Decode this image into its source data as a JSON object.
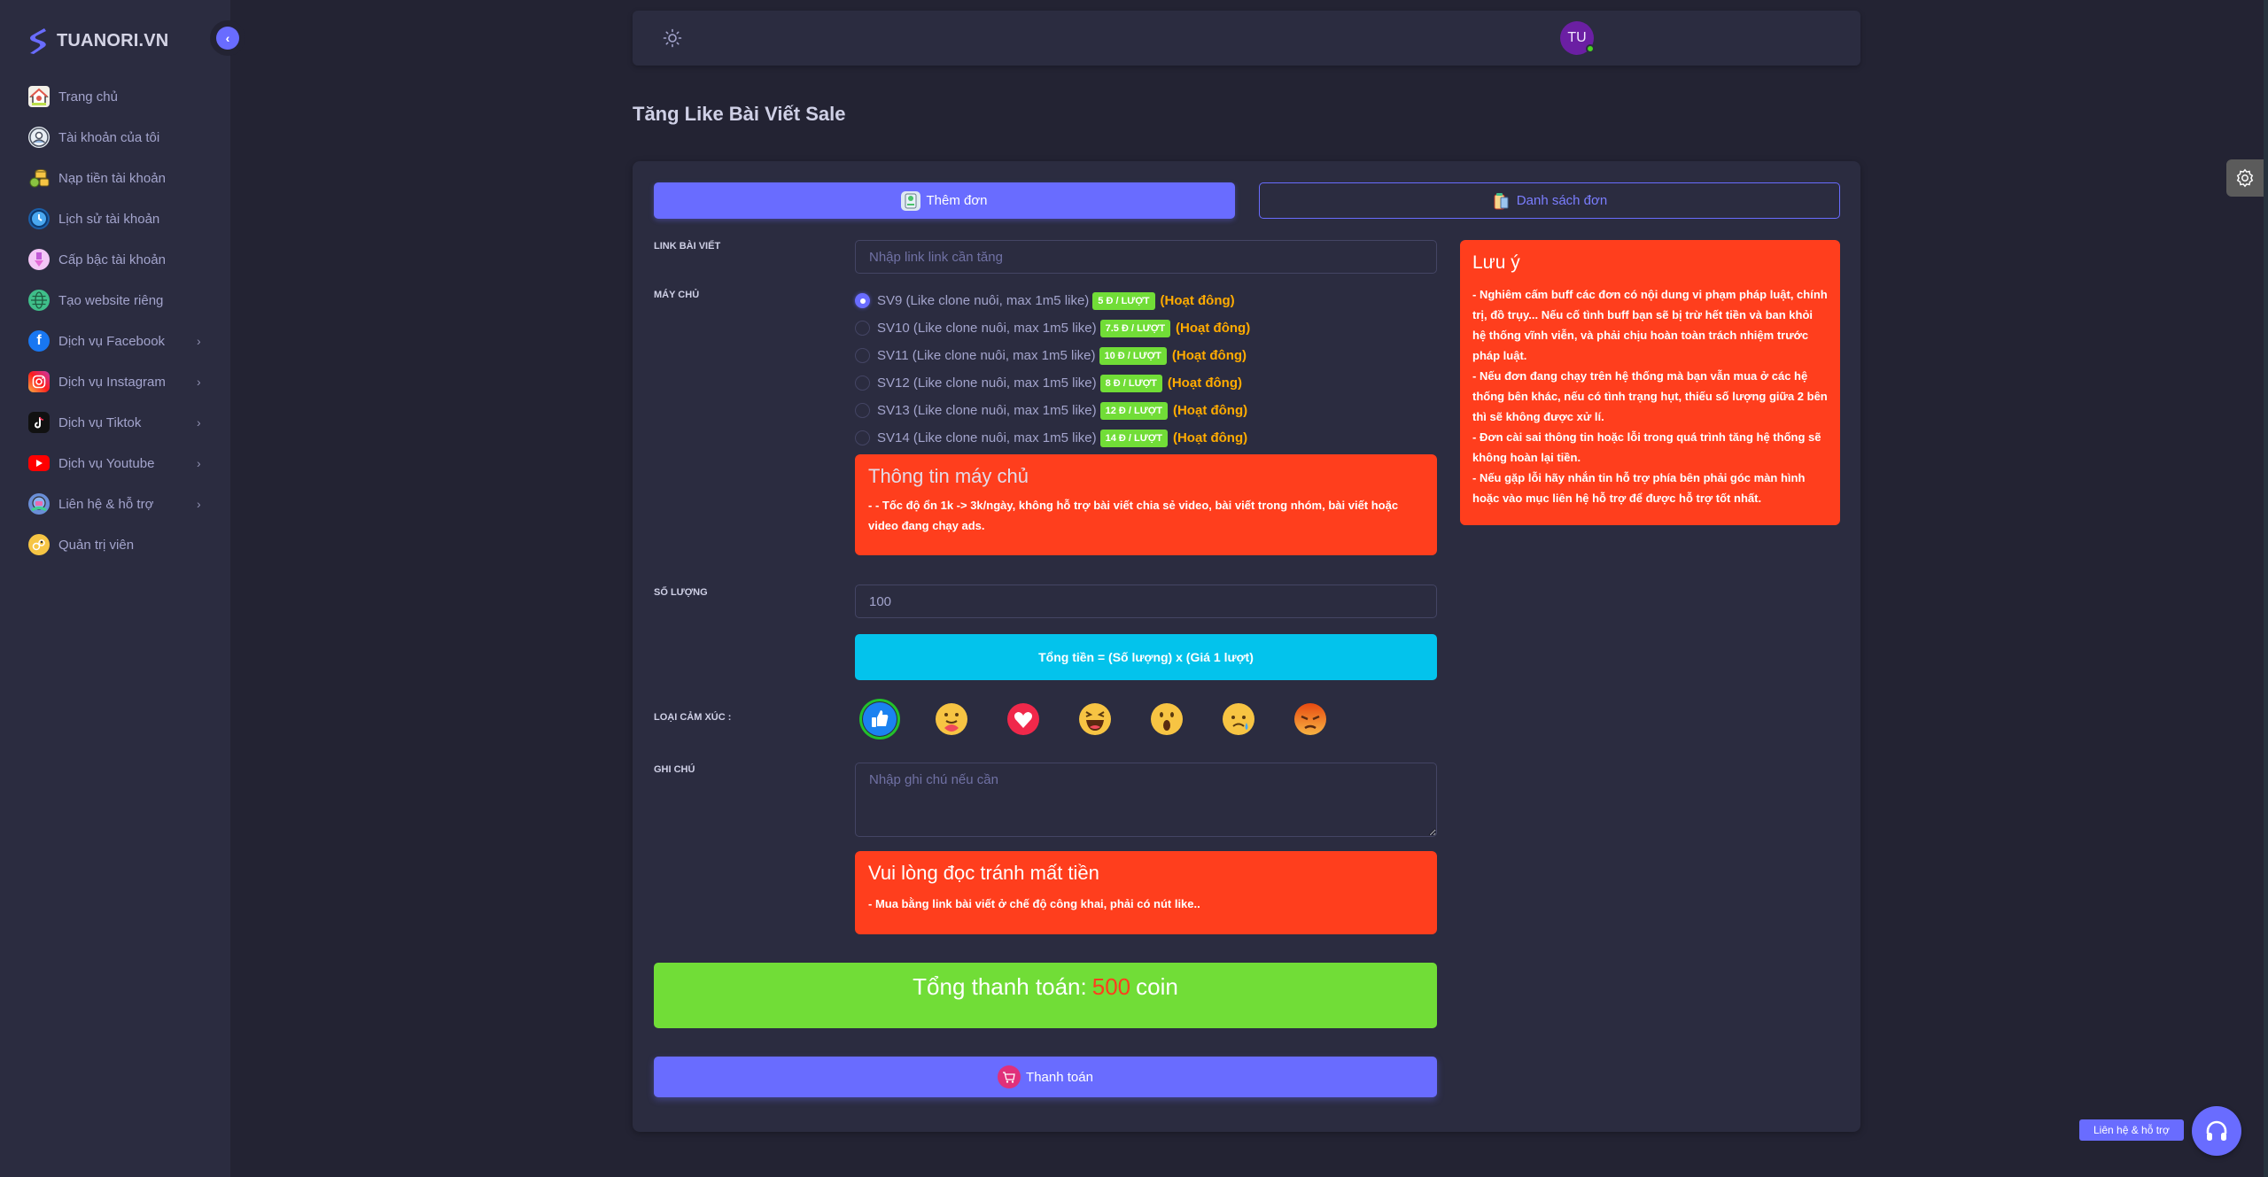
{
  "brand": {
    "name": "TUANORI.VN"
  },
  "sidebar": {
    "items": [
      {
        "label": "Trang chủ",
        "icon": "home-icon",
        "has_submenu": false
      },
      {
        "label": "Tài khoản của tôi",
        "icon": "user-icon",
        "has_submenu": false
      },
      {
        "label": "Nạp tiền tài khoản",
        "icon": "coins-icon",
        "has_submenu": false
      },
      {
        "label": "Lịch sử tài khoản",
        "icon": "clock-icon",
        "has_submenu": false
      },
      {
        "label": "Cấp bậc tài khoản",
        "icon": "rank-icon",
        "has_submenu": false
      },
      {
        "label": "Tạo website riêng",
        "icon": "globe-icon",
        "has_submenu": false
      },
      {
        "label": "Dịch vụ Facebook",
        "icon": "facebook-icon",
        "has_submenu": true
      },
      {
        "label": "Dịch vụ Instagram",
        "icon": "instagram-icon",
        "has_submenu": true
      },
      {
        "label": "Dịch vụ Tiktok",
        "icon": "tiktok-icon",
        "has_submenu": true
      },
      {
        "label": "Dịch vụ Youtube",
        "icon": "youtube-icon",
        "has_submenu": true
      },
      {
        "label": "Liên hệ & hỗ trợ",
        "icon": "support-icon",
        "has_submenu": true
      },
      {
        "label": "Quản trị viên",
        "icon": "admin-icon",
        "has_submenu": false
      }
    ],
    "chevron": "›",
    "collapse": "‹"
  },
  "header": {
    "avatar_initials": "TU",
    "status": "online"
  },
  "page": {
    "title": "Tăng Like Bài Viết Sale"
  },
  "tabs": {
    "add_order": "Thêm đơn",
    "order_list": "Danh sách đơn"
  },
  "form": {
    "link": {
      "label": "LINK BÀI VIẾT",
      "placeholder": "Nhập link link cần tăng",
      "value": ""
    },
    "server": {
      "label": "MÁY CHỦ",
      "selected": "SV9",
      "options": [
        {
          "id": "SV9",
          "name": "SV9 (Like clone nuôi, max 1m5 like)",
          "price": "5 Đ / LƯỢT",
          "status": "(Hoạt đông)"
        },
        {
          "id": "SV10",
          "name": "SV10 (Like clone nuôi, max 1m5 like)",
          "price": "7.5 Đ / LƯỢT",
          "status": "(Hoạt đông)"
        },
        {
          "id": "SV11",
          "name": "SV11 (Like clone nuôi, max 1m5 like)",
          "price": "10 Đ / LƯỢT",
          "status": "(Hoạt đông)"
        },
        {
          "id": "SV12",
          "name": "SV12 (Like clone nuôi, max 1m5 like)",
          "price": "8 Đ / LƯỢT",
          "status": "(Hoạt đông)"
        },
        {
          "id": "SV13",
          "name": "SV13 (Like clone nuôi, max 1m5 like)",
          "price": "12 Đ / LƯỢT",
          "status": "(Hoạt đông)"
        },
        {
          "id": "SV14",
          "name": "SV14 (Like clone nuôi, max 1m5 like)",
          "price": "14 Đ / LƯỢT",
          "status": "(Hoạt đông)"
        }
      ]
    },
    "server_info": {
      "title": "Thông tin máy chủ",
      "body": "- - Tốc độ ổn 1k -> 3k/ngày, không hỗ trợ bài viết chia sẻ video, bài viết trong nhóm, bài viết hoặc video đang chạy ads."
    },
    "quantity": {
      "label": "SỐ LƯỢNG",
      "value": "100"
    },
    "formula": "Tổng tiền = (Số lượng) x (Giá 1 lượt)",
    "reactions": {
      "label": "LOẠI CẢM XÚC :",
      "selected": "like",
      "options": [
        "like",
        "care",
        "love",
        "haha",
        "wow",
        "sad",
        "angry"
      ]
    },
    "note": {
      "label": "GHI CHÚ",
      "placeholder": "Nhập ghi chú nếu cần",
      "value": ""
    },
    "warning": {
      "title": "Vui lòng đọc tránh mất tiền",
      "body": "- Mua bằng link bài viết ở chế độ công khai, phải có nút like.."
    },
    "total": {
      "prefix": "Tổng thanh toán:",
      "amount": "500",
      "unit": "coin"
    },
    "pay_button": "Thanh toán"
  },
  "notice": {
    "title": "Lưu ý",
    "lines": [
      "- Nghiêm cấm buff các đơn có nội dung vi phạm pháp luật, chính trị, đồ trụy... Nếu cố tình buff bạn sẽ bị trừ hết tiền và ban khỏi hệ thống vĩnh viễn, và phải chịu hoàn toàn trách nhiệm trước pháp luật.",
      "- Nếu đơn đang chạy trên hệ thống mà bạn vẫn mua ở các hệ thống bên khác, nếu có tình trạng hụt, thiếu số lượng giữa 2 bên thì sẽ không được xử lí.",
      "- Đơn cài sai thông tin hoặc lỗi trong quá trình tăng hệ thống sẽ không hoàn lại tiền.",
      "- Nếu gặp lỗi hãy nhắn tin hỗ trợ phía bên phải góc màn hình hoặc vào mục liên hệ hỗ trợ để được hỗ trợ tốt nhất."
    ]
  },
  "floating": {
    "support_label": "Liên hệ & hỗ trợ"
  },
  "colors": {
    "primary": "#696cff",
    "danger": "#ff3e1d",
    "success": "#71dd37",
    "info": "#03c3ec",
    "warning": "#ffab00",
    "sidebar_bg": "#2b2c40",
    "page_bg": "#232333"
  }
}
